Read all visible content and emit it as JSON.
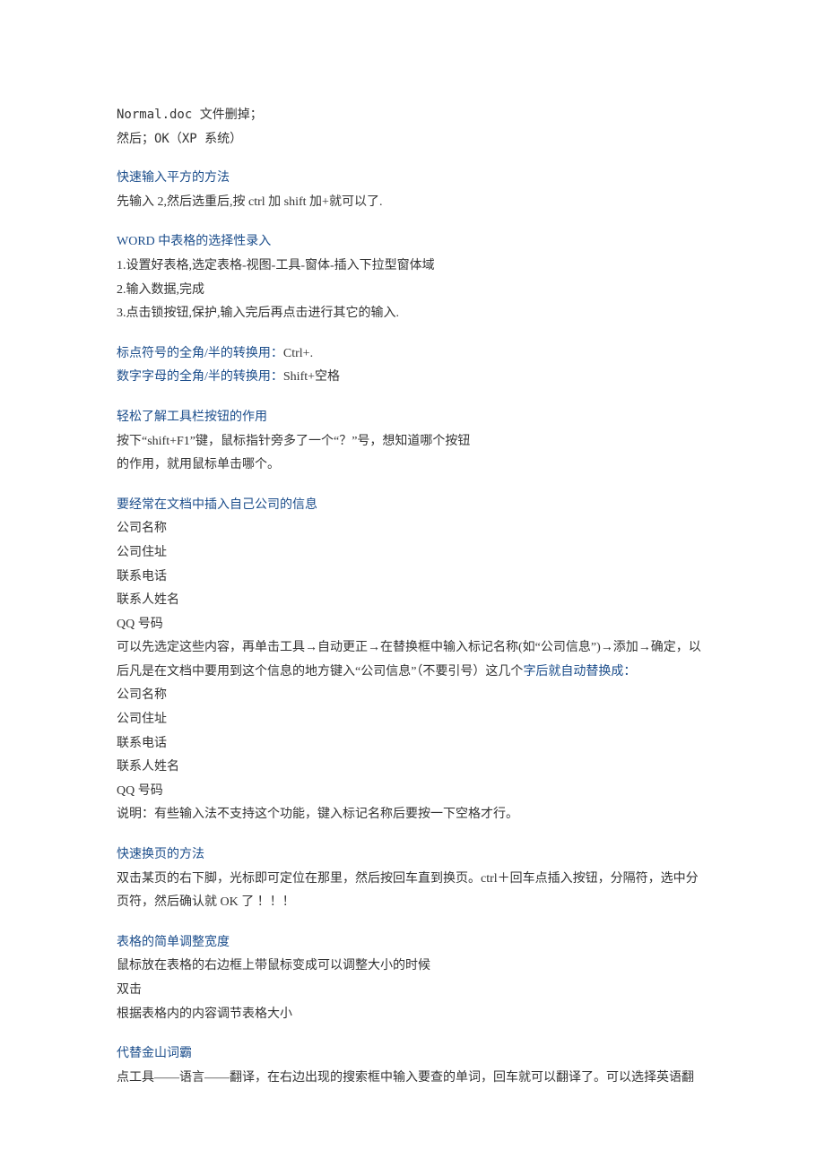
{
  "intro": {
    "line1": "Normal.doc 文件删掉；",
    "line2": "然后；OK（XP 系统）"
  },
  "s1": {
    "heading": "快速输入平方的方法",
    "body1": "先输入 2,然后选重后,按 ctrl 加 shift 加+就可以了."
  },
  "s2": {
    "heading": "WORD 中表格的选择性录入",
    "body1": "1.设置好表格,选定表格-视图-工具-窗体-插入下拉型窗体域",
    "body2": "2.输入数据,完成",
    "body3": "3.点击锁按钮,保护,输入完后再点击进行其它的输入."
  },
  "s3": {
    "heading1": "标点符号的全角/半的转换用：",
    "tail1": "Ctrl+.",
    "heading2": "数字字母的全角/半的转换用：",
    "tail2": "Shift+空格"
  },
  "s4": {
    "heading": "轻松了解工具栏按钮的作用",
    "body1": "按下“shift+F1”键，鼠标指针旁多了一个“？”号，想知道哪个按钮",
    "body2": "的作用，就用鼠标单击哪个。"
  },
  "s5": {
    "heading": "要经常在文档中插入自己公司的信息",
    "body1": "公司名称",
    "body2": "公司住址",
    "body3": "联系电话",
    "body4": "联系人姓名",
    "body5": "QQ 号码",
    "body6a": "可以先选定这些内容，再单击工具→自动更正→在替换框中输入标记名称(如“公司信息”)→添加→确定，以后凡是在文档中要用到这个信息的地方键入“公司信息”（不要引号）这几个",
    "body6b": "字后就自动替换成：",
    "body7": "公司名称",
    "body8": "公司住址",
    "body9": "联系电话",
    "body10": "联系人姓名",
    "body11": "QQ 号码",
    "body12": "说明：有些输入法不支持这个功能，键入标记名称后要按一下空格才行。"
  },
  "s6": {
    "heading": "快速换页的方法",
    "body1": "双击某页的右下脚，光标即可定位在那里，然后按回车直到换页。ctrl＋回车点插入按钮，分隔符，选中分页符，然后确认就 OK 了 ！！！"
  },
  "s7": {
    "heading": "表格的简单调整宽度",
    "body1": "鼠标放在表格的右边框上带鼠标变成可以调整大小的时候",
    "body2": "双击",
    "body3": "根据表格内的内容调节表格大小"
  },
  "s8": {
    "heading": "代替金山词霸",
    "body1": "点工具——语言——翻译，在右边出现的搜索框中输入要查的单词，回车就可以翻译了。可以选择英语翻"
  }
}
